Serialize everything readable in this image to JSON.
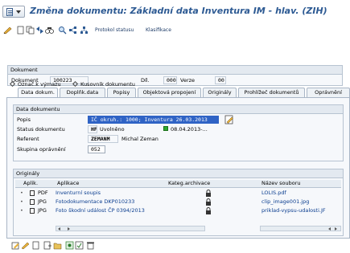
{
  "window": {
    "title": "Změna dokumentu: Základní data Inventura IM - hlav. (ZIH)"
  },
  "toolbar": {
    "protocol_label": "Protokol statusu",
    "classification_label": "Klasifikace"
  },
  "document": {
    "panel_title": "Dokument",
    "doc_label": "Dokument",
    "doc_value": "100223",
    "part_label": "Díl.",
    "part_value": "000",
    "version_label": "Verze",
    "version_value": "00",
    "radio_deletion": "Označ.k výmazu",
    "radio_bom": "Kusovník dokumentu"
  },
  "tabs": [
    "Data dokum.",
    "Doplňk.data",
    "Popisy",
    "Objektová propojení",
    "Originály",
    "Prohlížeč dokumentů",
    "Oprávnění"
  ],
  "data_section": {
    "title": "Data dokumentu",
    "desc_label": "Popis",
    "desc_value": "IČ okruh.: 1000; Inventura 26.03.2013",
    "status_label": "Status dokumentu",
    "status_code": "HF",
    "status_text": "Uvolněno",
    "status_date": "08.04.2013-...",
    "referent_label": "Referent",
    "referent_code": "ZEMANM",
    "referent_name": "Michal Zeman",
    "group_label": "Skupina oprávnění",
    "group_value": "052",
    "status_color": "#2faa2f"
  },
  "originals": {
    "title": "Originály",
    "columns": [
      "Aplik.",
      "Aplikace",
      "Kateg.archivace",
      "Název souboru"
    ],
    "rows": [
      {
        "type": "PDF",
        "app": "Inventurní soupis",
        "file": "LOLIS.pdf"
      },
      {
        "type": "JPG",
        "app": "Fotodokumentace DKP010233",
        "file": "clip_image001.jpg"
      },
      {
        "type": "JPG",
        "app": "Foto škodní událost ČP 0394/2013",
        "file": "priklad-vypsu-udalosti.JF"
      }
    ]
  }
}
